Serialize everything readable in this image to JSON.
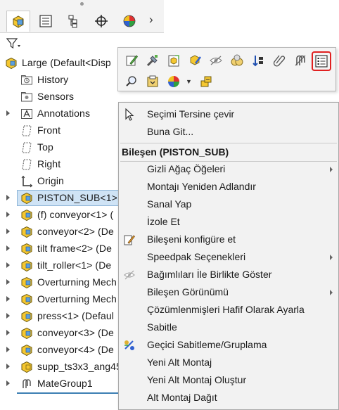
{
  "feature_manager": {
    "tabs": [
      {
        "name": "feature-tree"
      },
      {
        "name": "property-manager"
      },
      {
        "name": "configuration-manager"
      },
      {
        "name": "dimxpert-manager"
      },
      {
        "name": "display-manager"
      }
    ],
    "filter_icon": "filter-icon",
    "root": {
      "label": "Large  (Default<Disp"
    },
    "items": [
      {
        "label": "History",
        "icon": "history-folder-icon"
      },
      {
        "label": "Sensors",
        "icon": "sensors-icon"
      },
      {
        "label": "Annotations",
        "icon": "annotations-icon"
      },
      {
        "label": "Front",
        "icon": "plane-icon"
      },
      {
        "label": "Top",
        "icon": "plane-icon"
      },
      {
        "label": "Right",
        "icon": "plane-icon"
      },
      {
        "label": "Origin",
        "icon": "origin-icon"
      },
      {
        "label": "PISTON_SUB<1>",
        "icon": "subassembly-icon"
      },
      {
        "label": "(f) conveyor<1> (",
        "icon": "subassembly-icon"
      },
      {
        "label": "conveyor<2> (De",
        "icon": "subassembly-icon"
      },
      {
        "label": "tilt frame<2> (De",
        "icon": "subassembly-icon"
      },
      {
        "label": "tilt_roller<1> (De",
        "icon": "subassembly-icon"
      },
      {
        "label": "Overturning Mech",
        "icon": "subassembly-icon"
      },
      {
        "label": "Overturning Mech",
        "icon": "subassembly-icon"
      },
      {
        "label": "press<1> (Defaul",
        "icon": "subassembly-icon"
      },
      {
        "label": "conveyor<3> (De",
        "icon": "subassembly-icon"
      },
      {
        "label": "conveyor<4> (De",
        "icon": "subassembly-icon"
      },
      {
        "label": "supp_ts3x3_ang45",
        "icon": "subassembly-icon"
      },
      {
        "label": "MateGroup1",
        "icon": "mates-icon"
      }
    ]
  },
  "context_toolbar": {
    "row1": [
      "edit-component-icon",
      "edit-tool-icon",
      "open-assembly-icon",
      "appearance-icon",
      "hide-icon",
      "isolate-icon",
      "move-icon",
      "paperclip-icon",
      "mates-icon",
      "properties-icon"
    ],
    "row2": [
      "zoom-to-selection-icon",
      "display-pane-icon",
      "appearance-dropdown-icon",
      "make-virtual-icon"
    ],
    "highlighted": "properties-icon"
  },
  "context_menu": {
    "items_top": [
      {
        "label": "Seçimi Tersine çevir"
      },
      {
        "label": "Buna Git..."
      }
    ],
    "header": "Bileşen (PISTON_SUB)",
    "items": [
      {
        "label": "Gizli Ağaç Öğeleri",
        "submenu": true
      },
      {
        "label": "Montajı Yeniden Adlandır"
      },
      {
        "label": "Sanal Yap"
      },
      {
        "label": "İzole Et"
      },
      {
        "label": "Bileşeni konfigüre et"
      },
      {
        "label": "Speedpak Seçenekleri",
        "submenu": true
      },
      {
        "label": "Bağımlıları İle Birlikte Göster"
      },
      {
        "label": "Bileşen Görünümü",
        "submenu": true
      },
      {
        "label": "Çözümlenmişleri Hafif Olarak Ayarla"
      },
      {
        "label": "Sabitle"
      },
      {
        "label": "Geçici Sabitleme/Gruplama"
      },
      {
        "label": "Yeni Alt Montaj"
      },
      {
        "label": "Yeni Alt Montaj Oluştur"
      },
      {
        "label": "Alt Montaj Dağıt"
      }
    ]
  },
  "colors": {
    "accent": "#3d7fb3",
    "highlight": "#e02020",
    "selection": "#cfe3f5"
  }
}
